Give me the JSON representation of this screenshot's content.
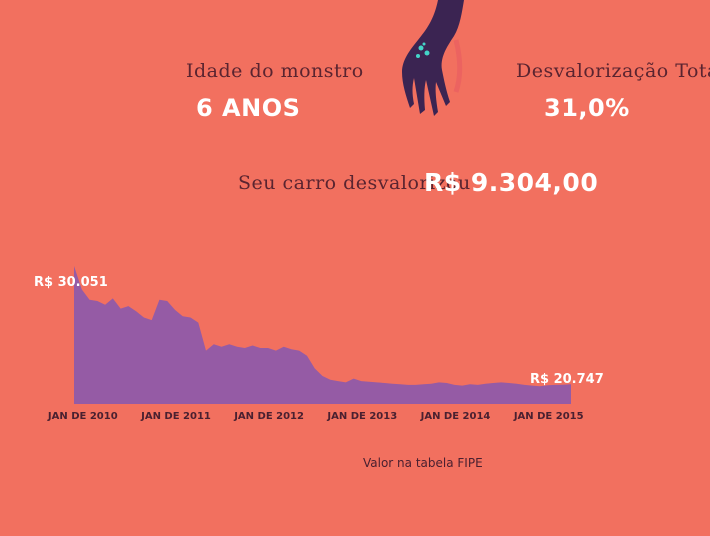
{
  "stats": {
    "age_label": "Idade do monstro",
    "age_value": "6 ANOS",
    "depreciation_label": "Desvalorização Total",
    "depreciation_value": "31,0%",
    "car_label": "Seu carro desvalorizou",
    "car_value": "R$ 9.304,00"
  },
  "chart_data": {
    "type": "area",
    "x": [
      "2009-12",
      "2010-01",
      "2010-02",
      "2010-03",
      "2010-04",
      "2010-05",
      "2010-06",
      "2010-07",
      "2010-08",
      "2010-09",
      "2010-10",
      "2010-11",
      "2010-12",
      "2011-01",
      "2011-02",
      "2011-03",
      "2011-04",
      "2011-05",
      "2011-06",
      "2011-07",
      "2011-08",
      "2011-09",
      "2011-10",
      "2011-11",
      "2011-12",
      "2012-01",
      "2012-02",
      "2012-03",
      "2012-04",
      "2012-05",
      "2012-06",
      "2012-07",
      "2012-08",
      "2012-09",
      "2012-10",
      "2012-11",
      "2012-12",
      "2013-01",
      "2013-02",
      "2013-03",
      "2013-04",
      "2013-05",
      "2013-06",
      "2013-07",
      "2013-08",
      "2013-09",
      "2013-10",
      "2013-11",
      "2013-12",
      "2014-01",
      "2014-02",
      "2014-03",
      "2014-04",
      "2014-05",
      "2014-06",
      "2014-07",
      "2014-08",
      "2014-09",
      "2014-10",
      "2014-11",
      "2014-12",
      "2015-01",
      "2015-02",
      "2015-03",
      "2015-04"
    ],
    "values": [
      30051,
      28200,
      27400,
      27300,
      27000,
      27500,
      26700,
      26900,
      26500,
      26000,
      25800,
      27400,
      27300,
      26600,
      26100,
      26000,
      25600,
      23400,
      23900,
      23700,
      23900,
      23700,
      23600,
      23800,
      23600,
      23600,
      23400,
      23700,
      23500,
      23400,
      23000,
      22000,
      21400,
      21100,
      21000,
      20900,
      21200,
      21000,
      20950,
      20900,
      20850,
      20800,
      20750,
      20700,
      20700,
      20750,
      20800,
      20900,
      20850,
      20700,
      20650,
      20750,
      20700,
      20800,
      20850,
      20900,
      20850,
      20800,
      20700,
      20650,
      20600,
      20680,
      20700,
      20720,
      20747
    ],
    "x_tick_labels": [
      "JAN DE 2010",
      "JAN DE 2011",
      "JAN DE 2012",
      "JAN DE 2013",
      "JAN DE 2014",
      "JAN DE 2015"
    ],
    "start_label": "R$ 30.051",
    "end_label": "R$ 20.747",
    "xlabel": "Valor na tabela FIPE",
    "ylabel": "",
    "ylim": [
      19200,
      30051
    ],
    "grid": false,
    "fill_color": "#955ba5"
  }
}
